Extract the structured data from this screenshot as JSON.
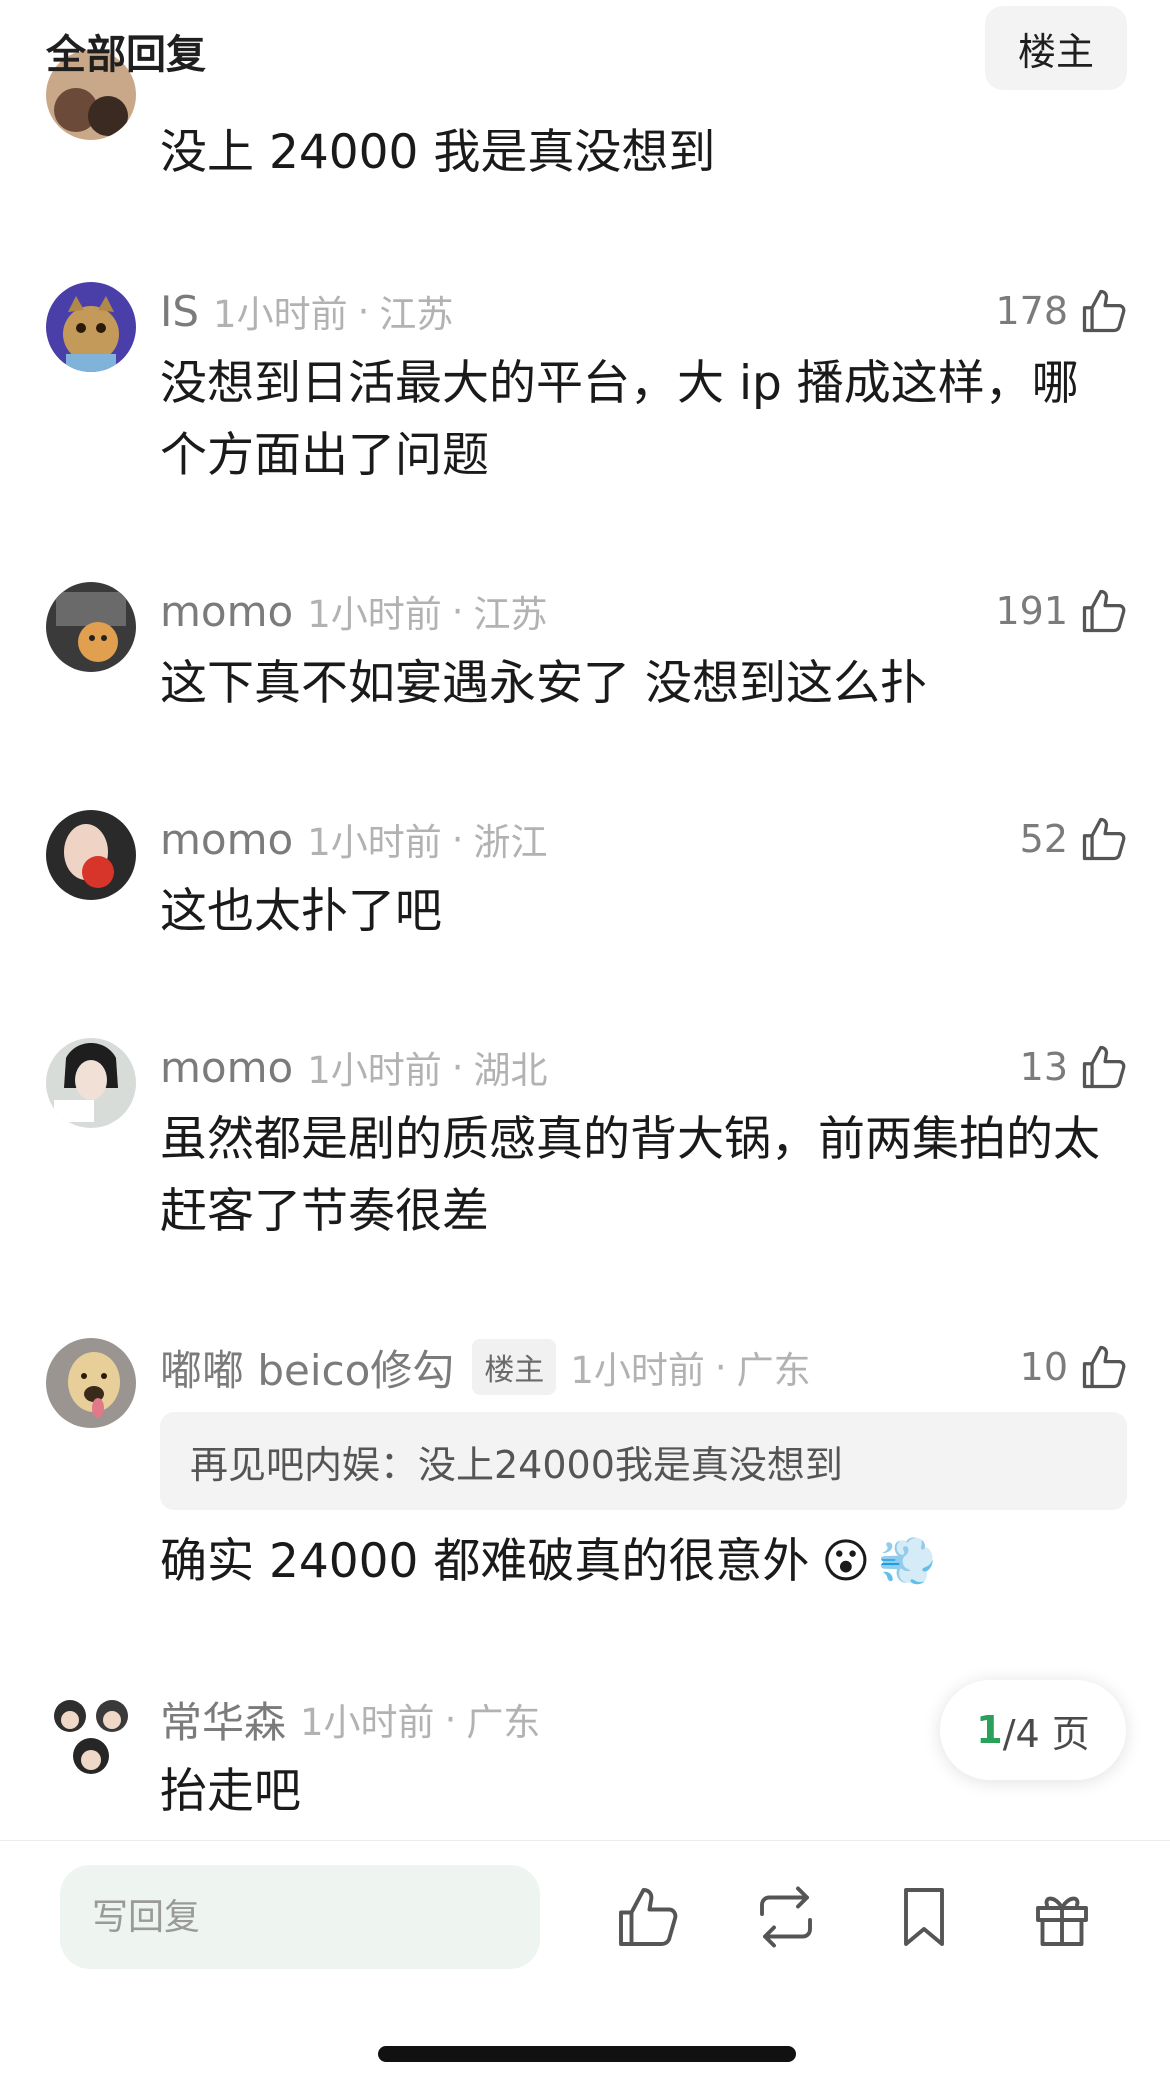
{
  "header": {
    "title": "全部回复",
    "owner_button": "楼主"
  },
  "comments": [
    {
      "text": "没上 24000 我是真没想到"
    },
    {
      "name": "IS",
      "time": "1小时前",
      "sep": "·",
      "region": "江苏",
      "likes": "178",
      "text": "没想到日活最大的平台，大 ip 播成这样，哪个方面出了问题"
    },
    {
      "name": "momo",
      "time": "1小时前",
      "sep": "·",
      "region": "江苏",
      "likes": "191",
      "text": "这下真不如宴遇永安了 没想到这么扑"
    },
    {
      "name": "momo",
      "time": "1小时前",
      "sep": "·",
      "region": "浙江",
      "likes": "52",
      "text": "这也太扑了吧"
    },
    {
      "name": "momo",
      "time": "1小时前",
      "sep": "·",
      "region": "湖北",
      "likes": "13",
      "text": "虽然都是剧的质感真的背大锅，前两集拍的太赶客了节奏很差"
    },
    {
      "name": "嘟嘟 beico修勾",
      "tag": "楼主",
      "time": "1小时前",
      "sep": "·",
      "region": "广东",
      "likes": "10",
      "quote": "再见吧内娱：没上24000我是真没想到",
      "text": "确实 24000 都难破真的很意外",
      "emojis": [
        "😮",
        "💨"
      ]
    },
    {
      "name": "常华森",
      "time": "1小时前",
      "sep": "·",
      "region": "广东",
      "text": "抬走吧"
    }
  ],
  "pagination": {
    "current": "1",
    "total": "/4 页"
  },
  "bottom_bar": {
    "reply_placeholder": "写回复",
    "icons": [
      "thumb-up-icon",
      "repost-icon",
      "bookmark-icon",
      "gift-icon"
    ]
  },
  "colors": {
    "accent": "#2aa05a",
    "meta": "#b2b2b2",
    "name": "#7b7b7b",
    "quote_bg": "#f3f3f3",
    "input_bg": "#eef5f0"
  }
}
